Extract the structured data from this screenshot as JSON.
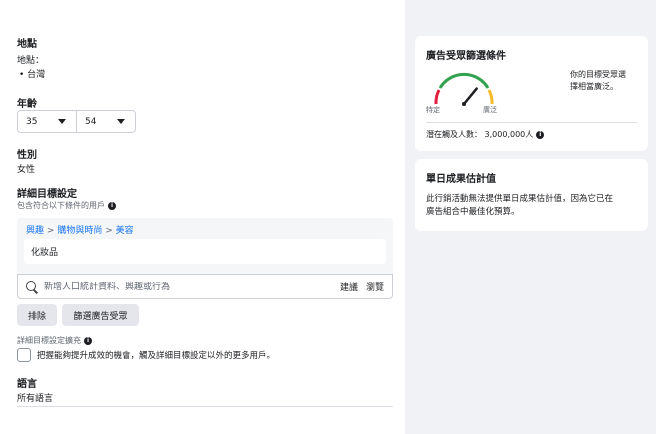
{
  "location": {
    "title": "地點",
    "label": "地點：",
    "items": [
      "• 台灣"
    ]
  },
  "age": {
    "title": "年齡",
    "min": "35",
    "max": "54"
  },
  "gender": {
    "title": "性別",
    "value": "女性"
  },
  "detailed": {
    "title": "詳細目標設定",
    "subtitle": "包含符合以下條件的用戶",
    "breadcrumb": {
      "part1": "興趣",
      "part2": "購物與時尚",
      "part3": "美容",
      "separator": ">"
    },
    "chip": "化妝品",
    "search_placeholder": "新增人口統計資料、興趣或行為",
    "suggest_label": "建議",
    "browse_label": "瀏覽",
    "exclude_label": "排除",
    "narrow_label": "篩選廣告受眾",
    "expansion_title": "詳細目標設定擴充",
    "expansion_text": "把握能夠提升成效的機會，觸及詳細目標設定以外的更多用戶。"
  },
  "language": {
    "title": "語言",
    "value": "所有語言"
  },
  "audience_card": {
    "title": "廣告受眾篩選條件",
    "gauge_left": "特定",
    "gauge_right": "廣泛",
    "gauge_level": 0.72,
    "description_line1": "你的目標受眾選",
    "description_line2": "擇相當廣泛。",
    "reach_label": "潛在觸及人數：",
    "reach_value": "3,000,000人"
  },
  "daily_card": {
    "title": "單日成果估計值",
    "text_line1": "此行銷活動無法提供單日成果估計值，因為它已在",
    "text_line2": "廣告組合中最佳化預算。"
  },
  "colors": {
    "link": "#1877f2",
    "gauge_red": "#e41e3f",
    "gauge_green": "#31a24c",
    "gauge_yellow": "#f7b928",
    "panel_bg": "#f0f2f5"
  }
}
